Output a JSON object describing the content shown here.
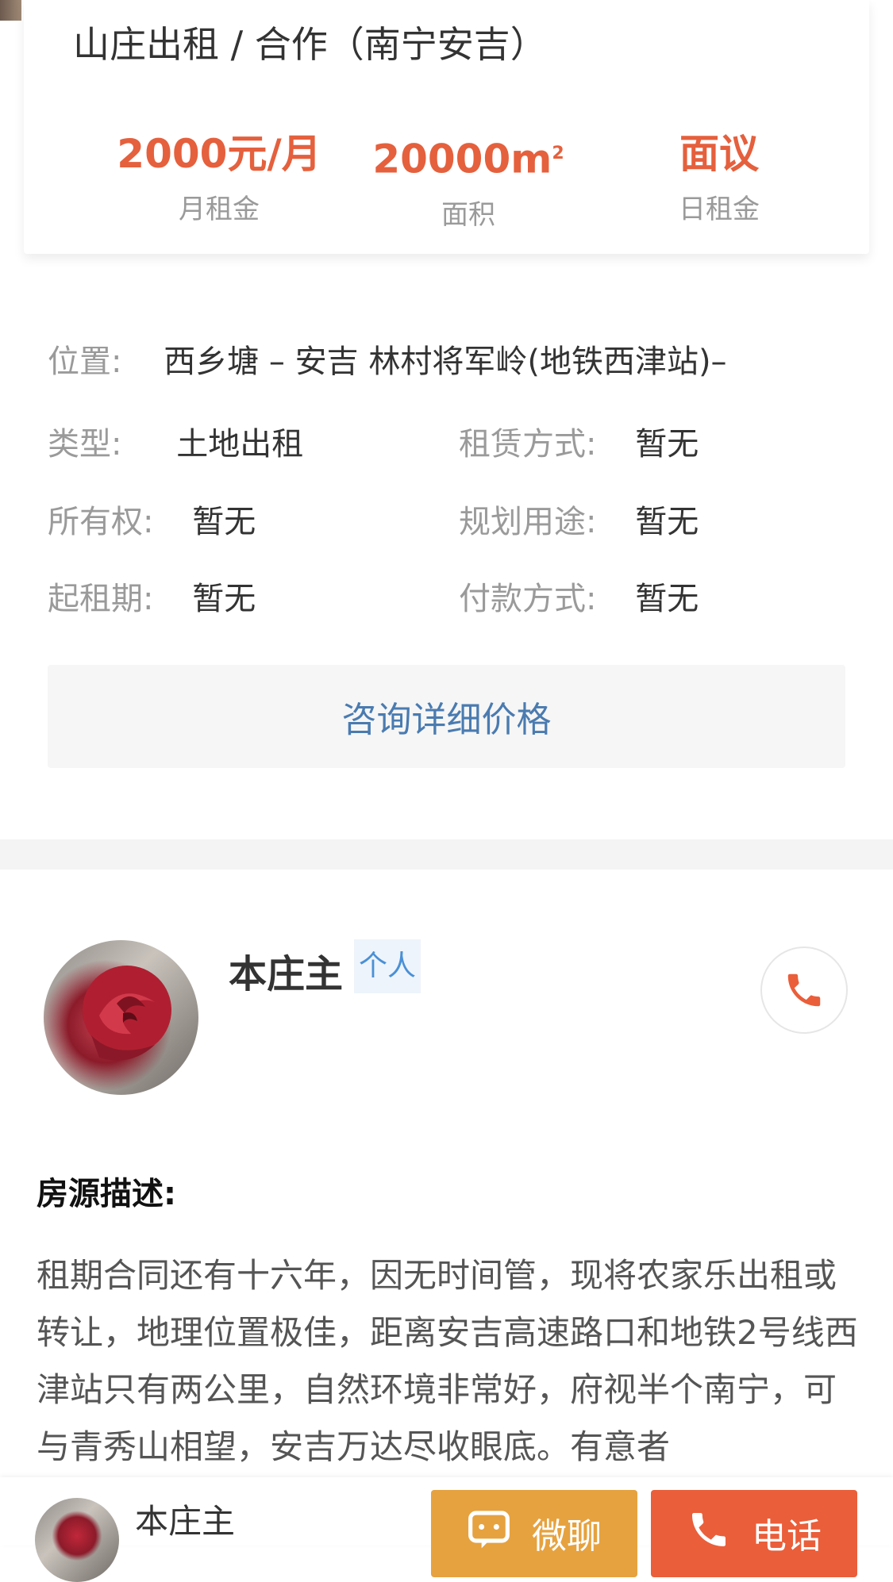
{
  "header": {
    "title": "山庄出租 / 合作（南宁安吉）",
    "stats": [
      {
        "value": "2000元/月",
        "label": "月租金"
      },
      {
        "value": "20000m",
        "unit_sup": "2",
        "label": "面积"
      },
      {
        "value": "面议",
        "label": "日租金"
      }
    ]
  },
  "details": {
    "location": {
      "label": "位置:",
      "value": "西乡塘 – 安吉 林村将军岭(地铁西津站)–"
    },
    "type": {
      "label": "类型:",
      "value": "土地出租"
    },
    "lease_method": {
      "label": "租赁方式:",
      "value": "暂无"
    },
    "ownership": {
      "label": "所有权:",
      "value": "暂无"
    },
    "planned_use": {
      "label": "规划用途:",
      "value": "暂无"
    },
    "min_term": {
      "label": "起租期:",
      "value": "暂无"
    },
    "payment": {
      "label": "付款方式:",
      "value": "暂无"
    },
    "consult_button": "咨询详细价格"
  },
  "owner": {
    "name": "本庄主",
    "tag": "个人",
    "call_icon": "phone-icon"
  },
  "description": {
    "title": "房源描述:",
    "body": "租期合同还有十六年，因无时间管，现将农家乐出租或转让，地理位置极佳，距离安吉高速路口和地铁2号线西津站只有两公里，自然环境非常好，府视半个南宁，可与青秀山相望，安吉万达尽收眼底。有意者"
  },
  "bottom_bar": {
    "name": "本庄主",
    "chat_label": "微聊",
    "call_label": "电话"
  },
  "colors": {
    "accent_price": "#e5603d",
    "link_blue": "#4a7bb0",
    "chat_button": "#e6a23f",
    "call_button": "#ea5e3a"
  }
}
